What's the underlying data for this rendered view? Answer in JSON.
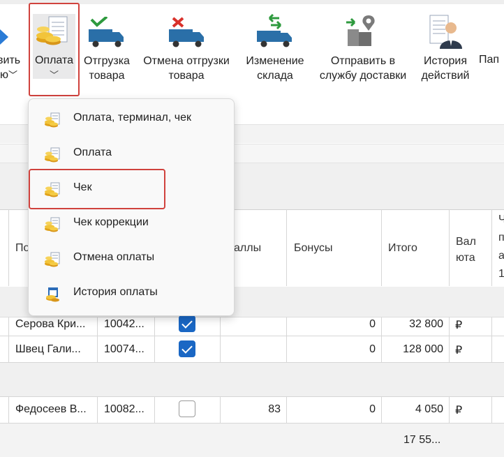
{
  "toolbar": {
    "partial_left_line1": "вить",
    "partial_left_line2": "ю",
    "pay": {
      "label": "Оплата",
      "chevron": "⌄"
    },
    "shipment": {
      "line1": "Отгрузка",
      "line2": "товара"
    },
    "cancel_shipment": {
      "line1": "Отмена отгрузки",
      "line2": "товара"
    },
    "change_warehouse": {
      "line1": "Изменение",
      "line2": "склада"
    },
    "send_delivery": {
      "line1": "Отправить в",
      "line2": "службу доставки"
    },
    "history": {
      "line1": "История",
      "line2": "действий"
    },
    "partial_right": "Пап"
  },
  "menu": {
    "items": [
      {
        "label": "Оплата, терминал, чек",
        "icon": "coins-document-icon"
      },
      {
        "label": "Оплата",
        "icon": "coins-document-icon"
      },
      {
        "label": "Чек",
        "icon": "coins-document-icon"
      },
      {
        "label": "Чек коррекции",
        "icon": "coins-document-icon"
      },
      {
        "label": "Отмена оплаты",
        "icon": "coins-document-icon"
      },
      {
        "label": "История оплаты",
        "icon": "calendar-coins-icon"
      }
    ],
    "selected_index": 2
  },
  "grid": {
    "headers": {
      "col_buyer": "По",
      "col_points": "аллы",
      "col_bonus": "Бонусы",
      "col_total": "Итого",
      "col_currency_line1": "Вал",
      "col_currency_line2": "юта",
      "col_last_line1": "Ч",
      "col_last_line2": "п",
      "col_last_line3": "а",
      "col_last_line4": "1"
    },
    "rows": [
      {
        "buyer": "Серова Кри...",
        "code": "10042...",
        "checked": true,
        "points": "",
        "bonus": "0",
        "total": "32 800",
        "currency": "₽"
      },
      {
        "buyer": "Швец Гали...",
        "code": "10074...",
        "checked": true,
        "points": "",
        "bonus": "0",
        "total": "128 000",
        "currency": "₽"
      },
      {
        "buyer": "Федосеев В...",
        "code": "10082...",
        "checked": false,
        "points": "83",
        "bonus": "0",
        "total": "4 050",
        "currency": "₽"
      }
    ],
    "footer_total": "17 55..."
  },
  "colors": {
    "accent": "#1a67c4",
    "highlight_border": "#d0423d"
  }
}
